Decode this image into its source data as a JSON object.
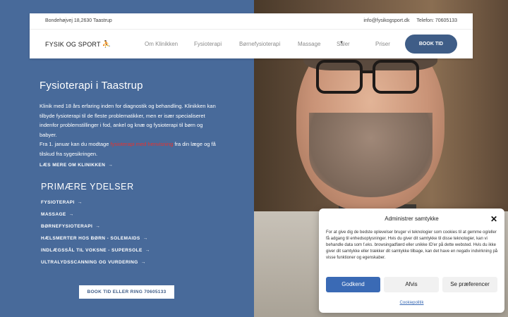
{
  "topbar": {
    "address": "Bondehøjvej 18,2630 Taastrup",
    "email": "info@fysikogsport.dk",
    "phone": "Telefon: 70605133"
  },
  "logo": {
    "text": "FYSIK OG SPORT",
    "icon": "runner-icon"
  },
  "nav": {
    "items": [
      "Om Klinikken",
      "Fysioterapi",
      "Børnefysioterapi",
      "Massage",
      "Såler",
      "Priser"
    ],
    "book_label": "BOOK TID"
  },
  "hero": {
    "title": "Fysioterapi i Taastrup",
    "para1": "Klinik med 18 års erfaring inden for diagnostik og behandling. Klinikken kan tilbyde fysioterapi til de fleste problematikker, men er især specialiseret indenfor problemstillinger i fod, ankel og knæ og fysioterapi til børn og babyer.",
    "para2_before": "Fra 1. januar kan du modtage ",
    "para2_link": "fysioterapi med henvisning",
    "para2_after": " fra din læge og få tilskud fra sygesikringen.",
    "more_label": "LÆS MERE OM KLINIKKEN",
    "link_color": "#e8322d"
  },
  "services": {
    "heading": "PRIMÆRE YDELSER",
    "items": [
      "FYSIOTERAPI",
      "MASSAGE",
      "BØRNEFYSIOTERAPI",
      "HÆLSMERTER HOS BØRN - SOLEMAIDS",
      "INDLÆGSSÅL TIL VOKSNE - SUPERSOLE",
      "ULTRALYDSSCANNING OG VURDERING"
    ]
  },
  "cta": {
    "label": "BOOK TID ELLER RING 70605133"
  },
  "consent": {
    "title": "Administrer samtykke",
    "text": "For at give dig de bedste oplevelser bruger vi teknologier som cookies til at gemme og/eller få adgang til enhedsoplysninger. Hvis du giver dit samtykke til disse teknologier, kan vi behandle data som f.eks. browsingadfærd eller unikke ID'er på dette websted. Hvis du ikke giver dit samtykke eller trækker dit samtykke tilbage, kan det have en negativ indvirkning på visse funktioner og egenskaber.",
    "accept": "Godkend",
    "deny": "Afvis",
    "prefs": "Se præferencer",
    "policy": "Cookiepolitik",
    "accent": "#3a6ab5"
  },
  "colors": {
    "panel": "#486a9a",
    "button": "#3f5d87"
  }
}
